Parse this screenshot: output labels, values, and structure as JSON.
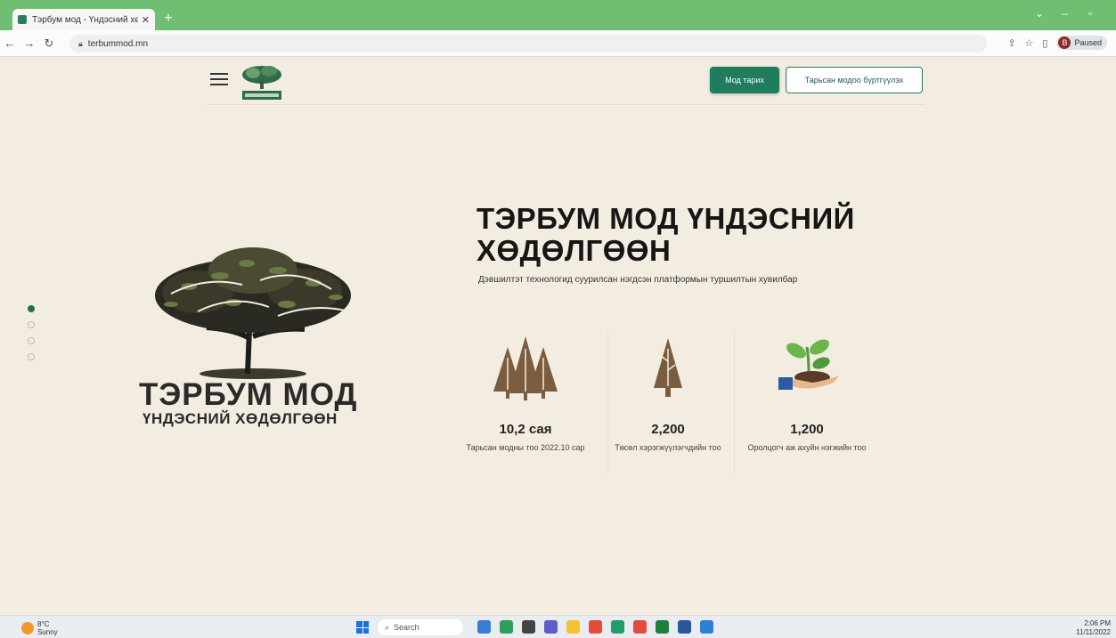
{
  "browser": {
    "tab_title": "Тэрбум мод - Үндэсний хөдөлгөөн",
    "tab_close": "✕",
    "new_tab": "+",
    "url": "terbummod.mn",
    "profile_label": "Paused",
    "profile_initial": "B"
  },
  "header": {
    "tree_button": "Мод тарих",
    "register_button": "Тарьсан модоо бүртгүүлэх",
    "accent_color": "#1f7d5e"
  },
  "brand": {
    "main": "ТЭРБУМ МОД",
    "sub": "ҮНДЭСНИЙ ХӨДӨЛГӨӨН"
  },
  "hero": {
    "title": "ТЭРБУМ МОД ҮНДЭСНИЙ ХӨДӨЛГӨӨН",
    "subtitle": "Дэвшилтэт технологид суурилсан нэгдсэн платформын туршилтын хувилбар"
  },
  "stats": [
    {
      "icon": "forest-icon",
      "value": "10,2 сая",
      "label": "Тарьсан модны тоо 2022.10 сар"
    },
    {
      "icon": "tree-icon",
      "value": "2,200",
      "label": "Төсөл хэрэгжүүлэгчдийн тоо"
    },
    {
      "icon": "seedling-hand-icon",
      "value": "1,200",
      "label": "Оролцогч аж ахуйн нэгжийн тоо"
    }
  ],
  "taskbar": {
    "weather": "8°C",
    "weather_sub": "Sunny",
    "search": "Search",
    "time": "2:06 PM",
    "date": "11/11/2022"
  }
}
